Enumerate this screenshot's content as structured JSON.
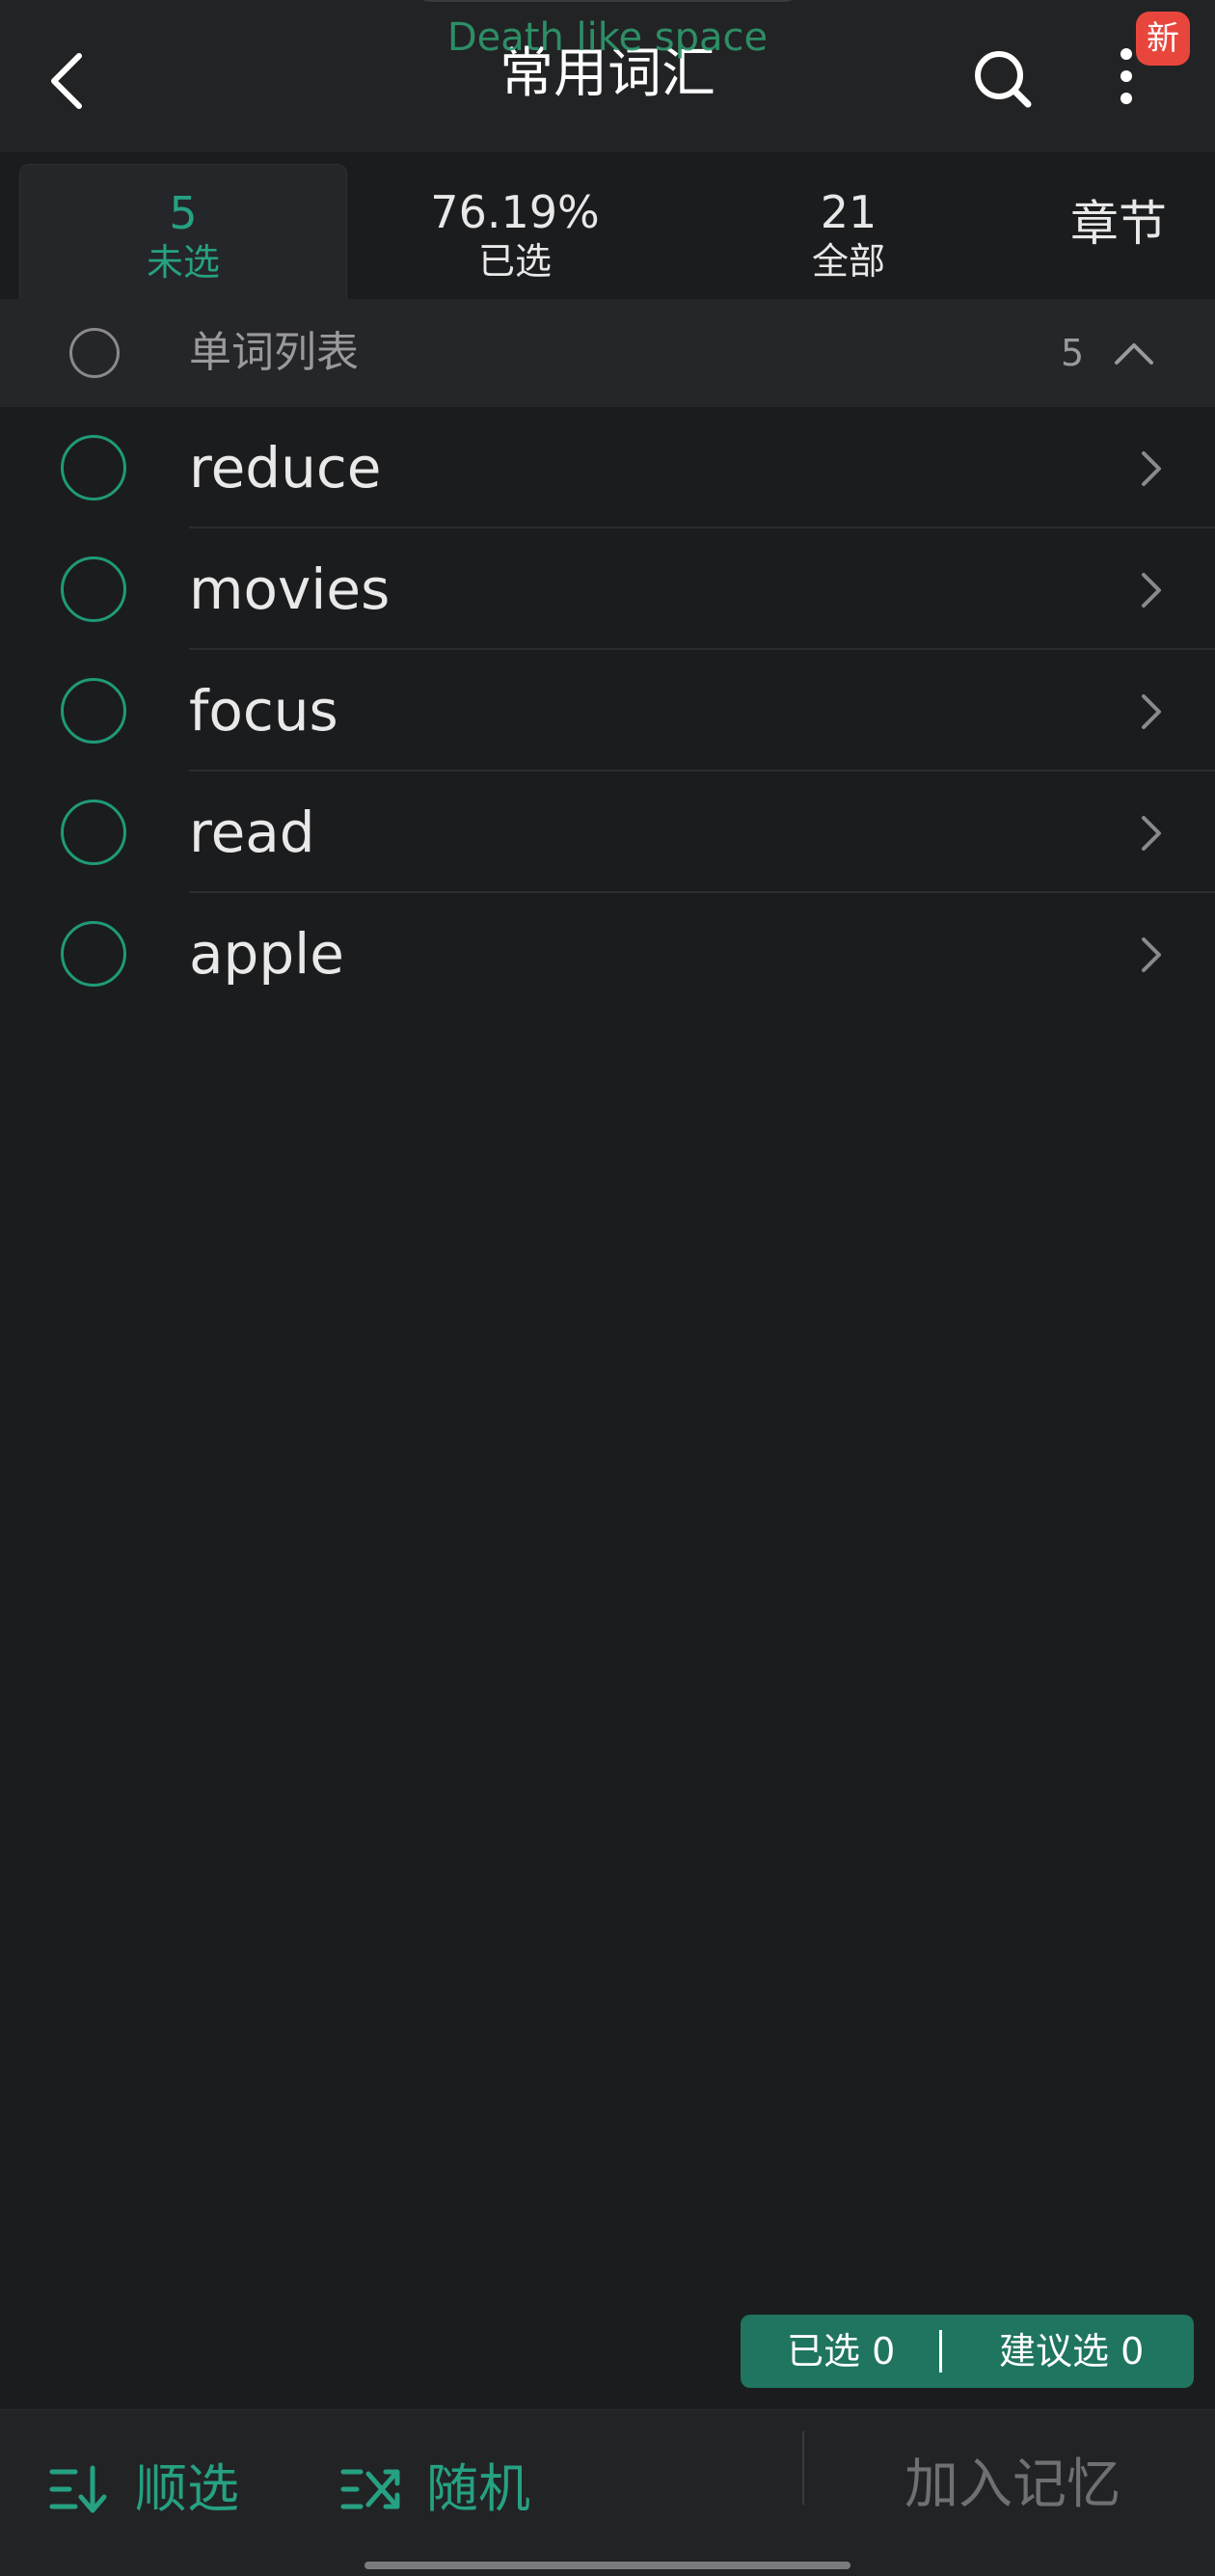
{
  "header": {
    "title": "常用词汇",
    "overlay_text": "Death like space",
    "badge": "新"
  },
  "tabs": [
    {
      "count": "5",
      "label": "未选",
      "active": true
    },
    {
      "count": "76.19%",
      "label": "已选",
      "active": false
    },
    {
      "count": "21",
      "label": "全部",
      "active": false
    }
  ],
  "chapter_tab": "章节",
  "section": {
    "title": "单词列表",
    "count": "5"
  },
  "words": [
    "reduce",
    "movies",
    "focus",
    "read",
    "apple"
  ],
  "selection": {
    "selected": "已选 0",
    "suggested": "建议选 0"
  },
  "bottom": {
    "sequential": "顺选",
    "random": "随机",
    "add_memory": "加入记忆"
  },
  "colors": {
    "accent": "#26a182",
    "badge": "#e8463d",
    "background": "#1b1c1e"
  },
  "icons": [
    "back-arrow-icon",
    "search-icon",
    "more-vertical-icon",
    "chevron-up-icon",
    "chevron-right-icon",
    "sort-down-icon",
    "shuffle-icon"
  ]
}
